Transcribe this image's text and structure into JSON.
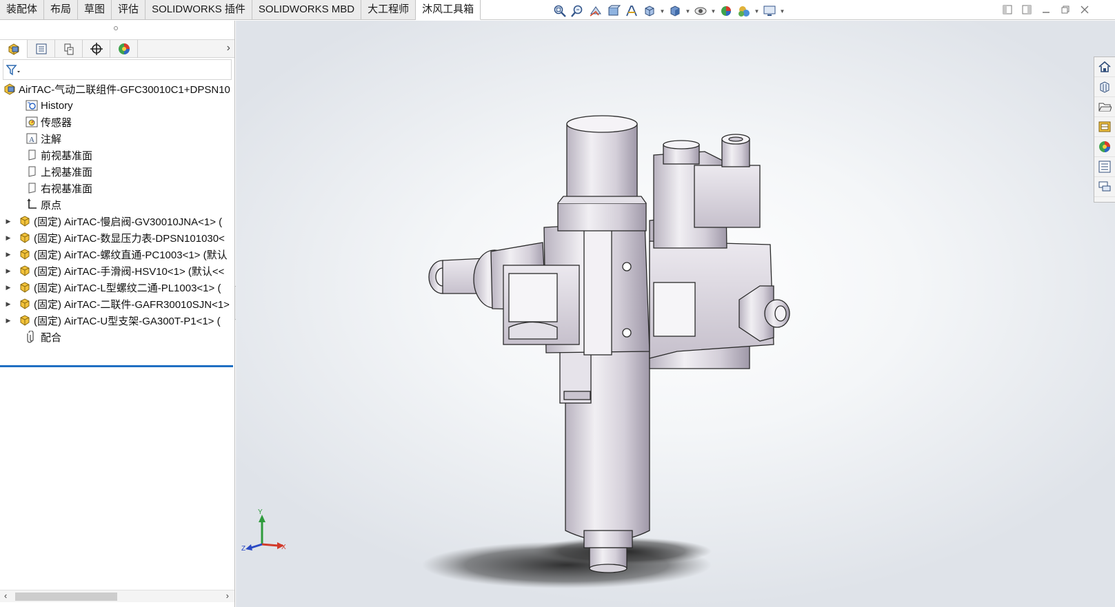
{
  "tabs": [
    "装配体",
    "布局",
    "草图",
    "评估",
    "SOLIDWORKS 插件",
    "SOLIDWORKS MBD",
    "大工程师",
    "沐风工具箱"
  ],
  "active_tab_index": 7,
  "hud_icons": [
    "zoom-to-fit-icon",
    "zoom-area-icon",
    "previous-view-icon",
    "section-view-icon",
    "dynamic-annotation-icon",
    "view-orientation-icon",
    "display-style-icon",
    "hide-show-icon",
    "edit-appearance-icon",
    "apply-scene-icon",
    "view-settings-icon"
  ],
  "panel_tabs": [
    "feature-manager",
    "property-manager",
    "configuration-manager",
    "dimxpert-manager",
    "display-manager"
  ],
  "tree": {
    "root": "AirTAC-气动二联组件-GFC30010C1+DPSN10",
    "items": [
      {
        "label": "History",
        "icon": "history-icon",
        "expandable": false
      },
      {
        "label": "传感器",
        "icon": "sensor-icon",
        "expandable": false
      },
      {
        "label": "注解",
        "icon": "annotation-icon",
        "expandable": false
      },
      {
        "label": "前视基准面",
        "icon": "plane-icon",
        "expandable": false
      },
      {
        "label": "上视基准面",
        "icon": "plane-icon",
        "expandable": false
      },
      {
        "label": "右视基准面",
        "icon": "plane-icon",
        "expandable": false
      },
      {
        "label": "原点",
        "icon": "origin-icon",
        "expandable": false
      },
      {
        "label": "(固定) AirTAC-慢启阀-GV30010JNA<1> (",
        "icon": "subassembly-icon",
        "expandable": true
      },
      {
        "label": "(固定) AirTAC-数显压力表-DPSN101030<",
        "icon": "subassembly-icon",
        "expandable": true
      },
      {
        "label": "(固定) AirTAC-螺纹直通-PC1003<1> (默认",
        "icon": "subassembly-icon",
        "expandable": true
      },
      {
        "label": "(固定) AirTAC-手滑阀-HSV10<1> (默认<<",
        "icon": "subassembly-icon",
        "expandable": true
      },
      {
        "label": "(固定) AirTAC-L型螺纹二通-PL1003<1> (",
        "icon": "subassembly-icon",
        "expandable": true
      },
      {
        "label": "(固定) AirTAC-二联件-GAFR30010SJN<1>",
        "icon": "subassembly-icon",
        "expandable": true
      },
      {
        "label": "(固定) AirTAC-U型支架-GA300T-P1<1> (",
        "icon": "subassembly-icon",
        "expandable": true
      },
      {
        "label": "配合",
        "icon": "mates-icon",
        "expandable": false
      }
    ]
  },
  "triad": {
    "x": "X",
    "y": "Y",
    "z": "Z"
  },
  "taskpane_icons": [
    "home-icon",
    "design-library-icon",
    "file-explorer-icon",
    "view-palette-icon",
    "appearances-icon",
    "custom-properties-icon",
    "forum-icon"
  ],
  "colors": {
    "accent": "#1f6fc2",
    "model": "#d8d4dc",
    "model_edge": "#2a2a2a"
  }
}
